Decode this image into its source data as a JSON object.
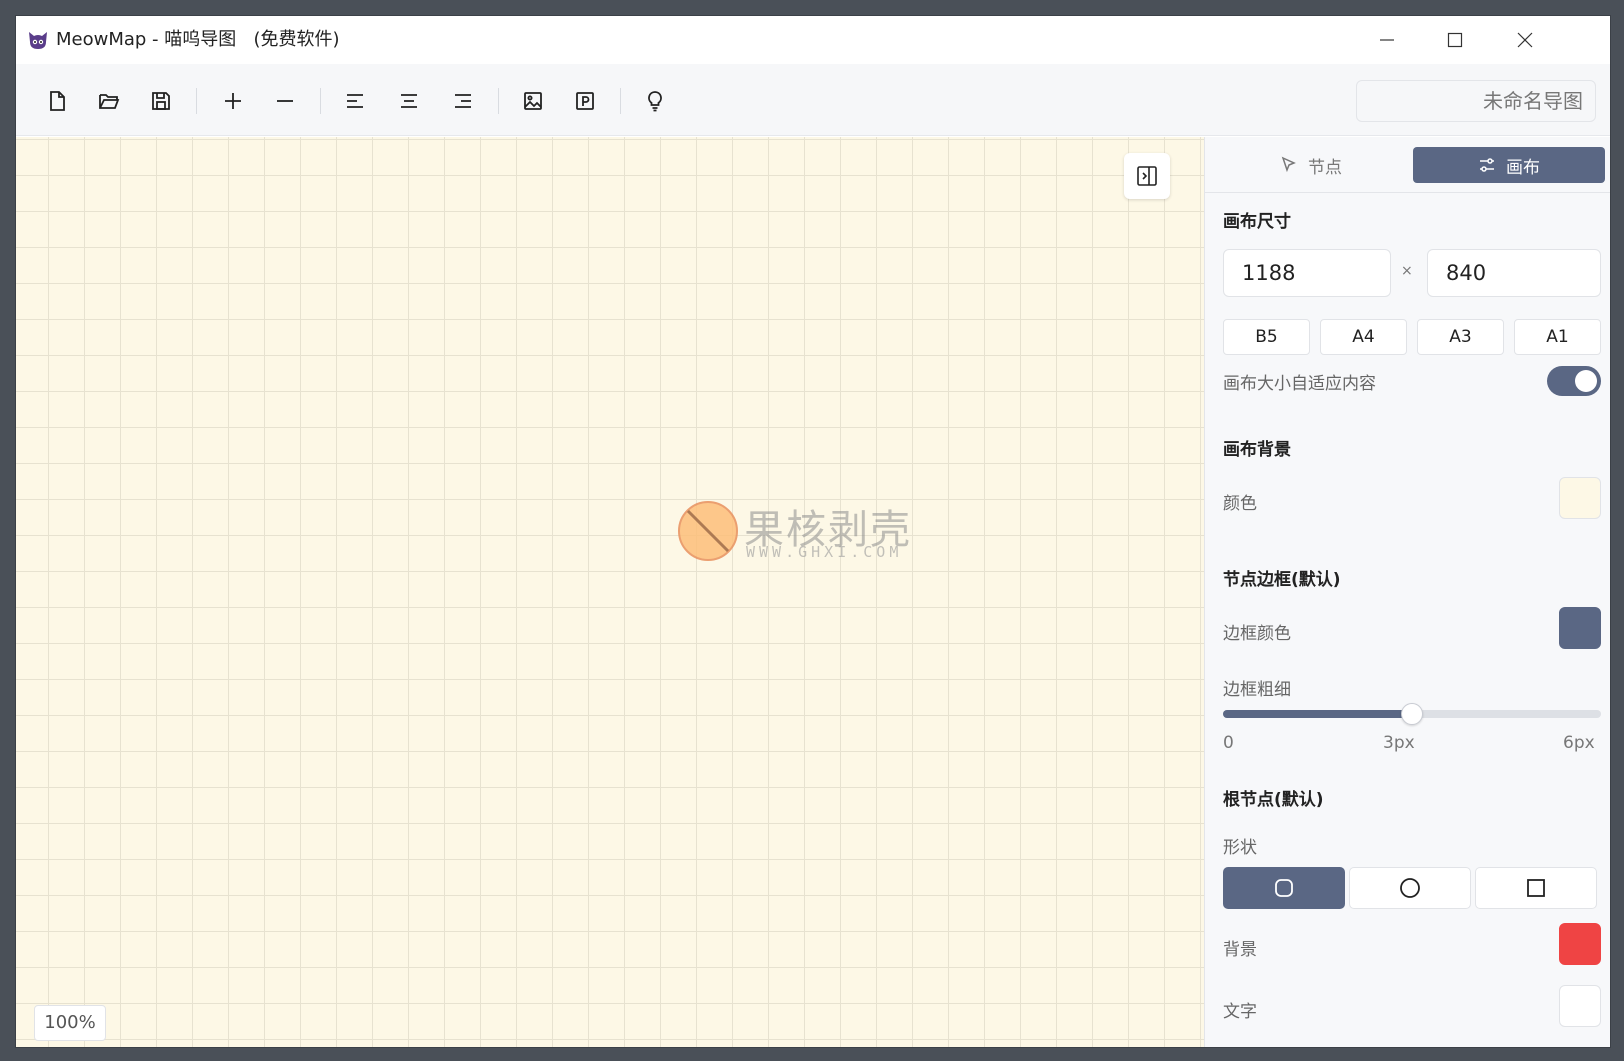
{
  "window": {
    "app_name": "MeowMap - 喵呜导图",
    "title_suffix": "(免费软件)",
    "file_name": "未命名导图"
  },
  "toolbar": {
    "buttons": [
      "new-file-icon",
      "open-folder-icon",
      "save-icon",
      "add-node-icon",
      "remove-node-icon",
      "align-left-icon",
      "align-center-icon",
      "align-right-icon",
      "insert-image-icon",
      "export-pdf-icon",
      "tip-lightbulb-icon"
    ]
  },
  "canvas": {
    "zoom": "100%",
    "background_color": "#fdf8e6",
    "watermark": {
      "text": "果核剥壳",
      "sub": "WWW.GHXI.COM"
    }
  },
  "panel": {
    "tabs": [
      {
        "label": "节点",
        "icon": "cursor-icon",
        "active": false
      },
      {
        "label": "画布",
        "icon": "sliders-icon",
        "active": true
      }
    ],
    "canvas_size": {
      "title": "画布尺寸",
      "width": "1188",
      "height": "840",
      "times": "×",
      "presets": [
        "B5",
        "A4",
        "A3",
        "A1"
      ],
      "auto_fit_label": "画布大小自适应内容",
      "auto_fit": true
    },
    "canvas_bg": {
      "title": "画布背景",
      "color_label": "颜色",
      "color": "#fdf8e6"
    },
    "node_border": {
      "title": "节点边框(默认)",
      "color_label": "边框颜色",
      "color": "#5a6784",
      "width_label": "边框粗细",
      "width_value_fraction": 0.5,
      "ticks": [
        "0",
        "3px",
        "6px"
      ]
    },
    "root_node": {
      "title": "根节点(默认)",
      "shape_label": "形状",
      "shapes": [
        "rounded-rect-icon",
        "circle-icon",
        "square-icon"
      ],
      "selected_shape": 0,
      "bg_label": "背景",
      "bg_color": "#ef4444",
      "text_label": "文字",
      "text_color": "#ffffff"
    }
  },
  "colors": {
    "accent": "#5a6784"
  }
}
